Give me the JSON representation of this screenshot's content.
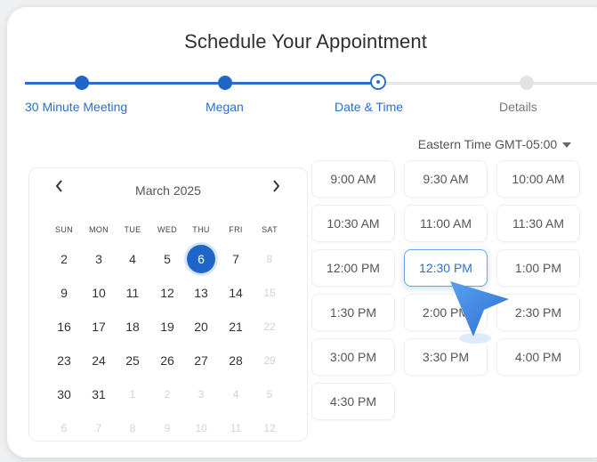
{
  "title": "Schedule Your Appointment",
  "steps": [
    {
      "label": "30 Minute Meeting",
      "state": "done"
    },
    {
      "label": "Megan",
      "state": "done"
    },
    {
      "label": "Date & Time",
      "state": "current"
    },
    {
      "label": "Details",
      "state": "upcoming"
    }
  ],
  "timezone": {
    "label": "Eastern Time GMT-05:00"
  },
  "calendar": {
    "month_label": "March 2025",
    "prev_icon": "chevron-left-icon",
    "next_icon": "chevron-right-icon",
    "weekdays": [
      "SUN",
      "MON",
      "TUE",
      "WED",
      "THU",
      "FRI",
      "SAT"
    ],
    "selected_day": "6",
    "weeks": [
      [
        "2",
        "3",
        "4",
        "5",
        "6",
        "7",
        "8"
      ],
      [
        "9",
        "10",
        "11",
        "12",
        "13",
        "14",
        "15"
      ],
      [
        "16",
        "17",
        "18",
        "19",
        "20",
        "21",
        "22"
      ],
      [
        "23",
        "24",
        "25",
        "26",
        "27",
        "28",
        "29"
      ],
      [
        "30",
        "31",
        "1",
        "2",
        "3",
        "4",
        "5"
      ],
      [
        "6",
        "7",
        "8",
        "9",
        "10",
        "11",
        "12"
      ]
    ]
  },
  "time_slots": [
    [
      "9:00 AM",
      "9:30 AM",
      "10:00 AM"
    ],
    [
      "10:30 AM",
      "11:00 AM",
      "11:30 AM"
    ],
    [
      "12:00 PM",
      "12:30 PM",
      "1:00 PM"
    ],
    [
      "1:30 PM",
      "2:00 PM",
      "2:30 PM"
    ],
    [
      "3:00 PM",
      "3:30 PM",
      "4:00 PM"
    ],
    [
      "4:30 PM"
    ]
  ],
  "selected_time": "12:30 PM",
  "colors": {
    "accent": "#1f66c8",
    "accent_light": "#2a6fd0"
  }
}
